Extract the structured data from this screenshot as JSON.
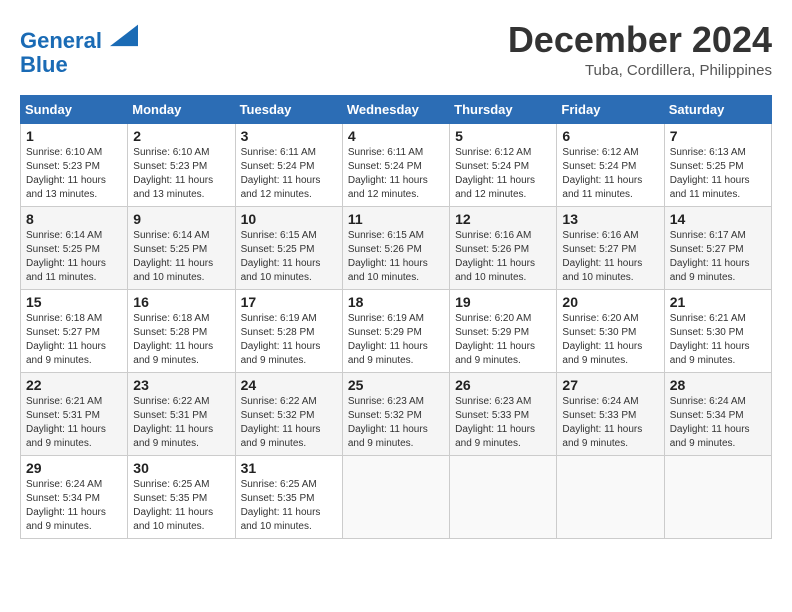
{
  "header": {
    "logo_line1": "General",
    "logo_line2": "Blue",
    "month_title": "December 2024",
    "location": "Tuba, Cordillera, Philippines"
  },
  "weekdays": [
    "Sunday",
    "Monday",
    "Tuesday",
    "Wednesday",
    "Thursday",
    "Friday",
    "Saturday"
  ],
  "weeks": [
    [
      {
        "day": "1",
        "sunrise": "6:10 AM",
        "sunset": "5:23 PM",
        "daylight": "11 hours and 13 minutes."
      },
      {
        "day": "2",
        "sunrise": "6:10 AM",
        "sunset": "5:23 PM",
        "daylight": "11 hours and 13 minutes."
      },
      {
        "day": "3",
        "sunrise": "6:11 AM",
        "sunset": "5:24 PM",
        "daylight": "11 hours and 12 minutes."
      },
      {
        "day": "4",
        "sunrise": "6:11 AM",
        "sunset": "5:24 PM",
        "daylight": "11 hours and 12 minutes."
      },
      {
        "day": "5",
        "sunrise": "6:12 AM",
        "sunset": "5:24 PM",
        "daylight": "11 hours and 12 minutes."
      },
      {
        "day": "6",
        "sunrise": "6:12 AM",
        "sunset": "5:24 PM",
        "daylight": "11 hours and 11 minutes."
      },
      {
        "day": "7",
        "sunrise": "6:13 AM",
        "sunset": "5:25 PM",
        "daylight": "11 hours and 11 minutes."
      }
    ],
    [
      {
        "day": "8",
        "sunrise": "6:14 AM",
        "sunset": "5:25 PM",
        "daylight": "11 hours and 11 minutes."
      },
      {
        "day": "9",
        "sunrise": "6:14 AM",
        "sunset": "5:25 PM",
        "daylight": "11 hours and 10 minutes."
      },
      {
        "day": "10",
        "sunrise": "6:15 AM",
        "sunset": "5:25 PM",
        "daylight": "11 hours and 10 minutes."
      },
      {
        "day": "11",
        "sunrise": "6:15 AM",
        "sunset": "5:26 PM",
        "daylight": "11 hours and 10 minutes."
      },
      {
        "day": "12",
        "sunrise": "6:16 AM",
        "sunset": "5:26 PM",
        "daylight": "11 hours and 10 minutes."
      },
      {
        "day": "13",
        "sunrise": "6:16 AM",
        "sunset": "5:27 PM",
        "daylight": "11 hours and 10 minutes."
      },
      {
        "day": "14",
        "sunrise": "6:17 AM",
        "sunset": "5:27 PM",
        "daylight": "11 hours and 9 minutes."
      }
    ],
    [
      {
        "day": "15",
        "sunrise": "6:18 AM",
        "sunset": "5:27 PM",
        "daylight": "11 hours and 9 minutes."
      },
      {
        "day": "16",
        "sunrise": "6:18 AM",
        "sunset": "5:28 PM",
        "daylight": "11 hours and 9 minutes."
      },
      {
        "day": "17",
        "sunrise": "6:19 AM",
        "sunset": "5:28 PM",
        "daylight": "11 hours and 9 minutes."
      },
      {
        "day": "18",
        "sunrise": "6:19 AM",
        "sunset": "5:29 PM",
        "daylight": "11 hours and 9 minutes."
      },
      {
        "day": "19",
        "sunrise": "6:20 AM",
        "sunset": "5:29 PM",
        "daylight": "11 hours and 9 minutes."
      },
      {
        "day": "20",
        "sunrise": "6:20 AM",
        "sunset": "5:30 PM",
        "daylight": "11 hours and 9 minutes."
      },
      {
        "day": "21",
        "sunrise": "6:21 AM",
        "sunset": "5:30 PM",
        "daylight": "11 hours and 9 minutes."
      }
    ],
    [
      {
        "day": "22",
        "sunrise": "6:21 AM",
        "sunset": "5:31 PM",
        "daylight": "11 hours and 9 minutes."
      },
      {
        "day": "23",
        "sunrise": "6:22 AM",
        "sunset": "5:31 PM",
        "daylight": "11 hours and 9 minutes."
      },
      {
        "day": "24",
        "sunrise": "6:22 AM",
        "sunset": "5:32 PM",
        "daylight": "11 hours and 9 minutes."
      },
      {
        "day": "25",
        "sunrise": "6:23 AM",
        "sunset": "5:32 PM",
        "daylight": "11 hours and 9 minutes."
      },
      {
        "day": "26",
        "sunrise": "6:23 AM",
        "sunset": "5:33 PM",
        "daylight": "11 hours and 9 minutes."
      },
      {
        "day": "27",
        "sunrise": "6:24 AM",
        "sunset": "5:33 PM",
        "daylight": "11 hours and 9 minutes."
      },
      {
        "day": "28",
        "sunrise": "6:24 AM",
        "sunset": "5:34 PM",
        "daylight": "11 hours and 9 minutes."
      }
    ],
    [
      {
        "day": "29",
        "sunrise": "6:24 AM",
        "sunset": "5:34 PM",
        "daylight": "11 hours and 9 minutes."
      },
      {
        "day": "30",
        "sunrise": "6:25 AM",
        "sunset": "5:35 PM",
        "daylight": "11 hours and 10 minutes."
      },
      {
        "day": "31",
        "sunrise": "6:25 AM",
        "sunset": "5:35 PM",
        "daylight": "11 hours and 10 minutes."
      },
      null,
      null,
      null,
      null
    ]
  ]
}
